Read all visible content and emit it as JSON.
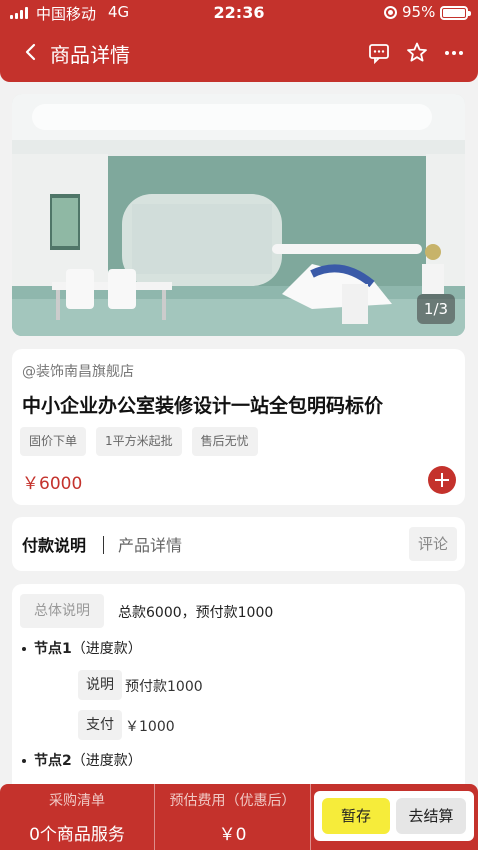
{
  "status_bar": {
    "carrier": "中国移动",
    "network": "4G",
    "time": "22:36",
    "battery": "95%"
  },
  "header": {
    "title": "商品详情",
    "icons": [
      "back-chevron-icon",
      "message-icon",
      "star-icon",
      "more-icon"
    ]
  },
  "gallery": {
    "pager": "1/3"
  },
  "product": {
    "shop": "@装饰南昌旗舰店",
    "title": "中小企业办公室装修设计一站全包明码标价",
    "tags": [
      "固价下单",
      "1平方米起批",
      "售后无忧"
    ],
    "price": "￥6000"
  },
  "tabs": {
    "payment": "付款说明",
    "details": "产品详情",
    "comment": "评论"
  },
  "payment": {
    "summary_label": "总体说明",
    "summary_text": "总款6000，预付款1000",
    "nodes": [
      {
        "title": "节点1",
        "sub": "（进度款）",
        "rows": [
          {
            "label": "说明",
            "value": "预付款1000"
          },
          {
            "label": "支付",
            "value": "￥1000"
          }
        ]
      },
      {
        "title": "节点2",
        "sub": "（进度款）",
        "rows": []
      }
    ]
  },
  "bottom_bar": {
    "list_label": "采购清单",
    "list_value": "0个商品服务",
    "cost_label": "预估费用（优惠后）",
    "cost_value": "￥0",
    "save": "暂存",
    "checkout": "去结算"
  },
  "colors": {
    "brand": "#c4322c",
    "save_button": "#f6ec3a"
  }
}
